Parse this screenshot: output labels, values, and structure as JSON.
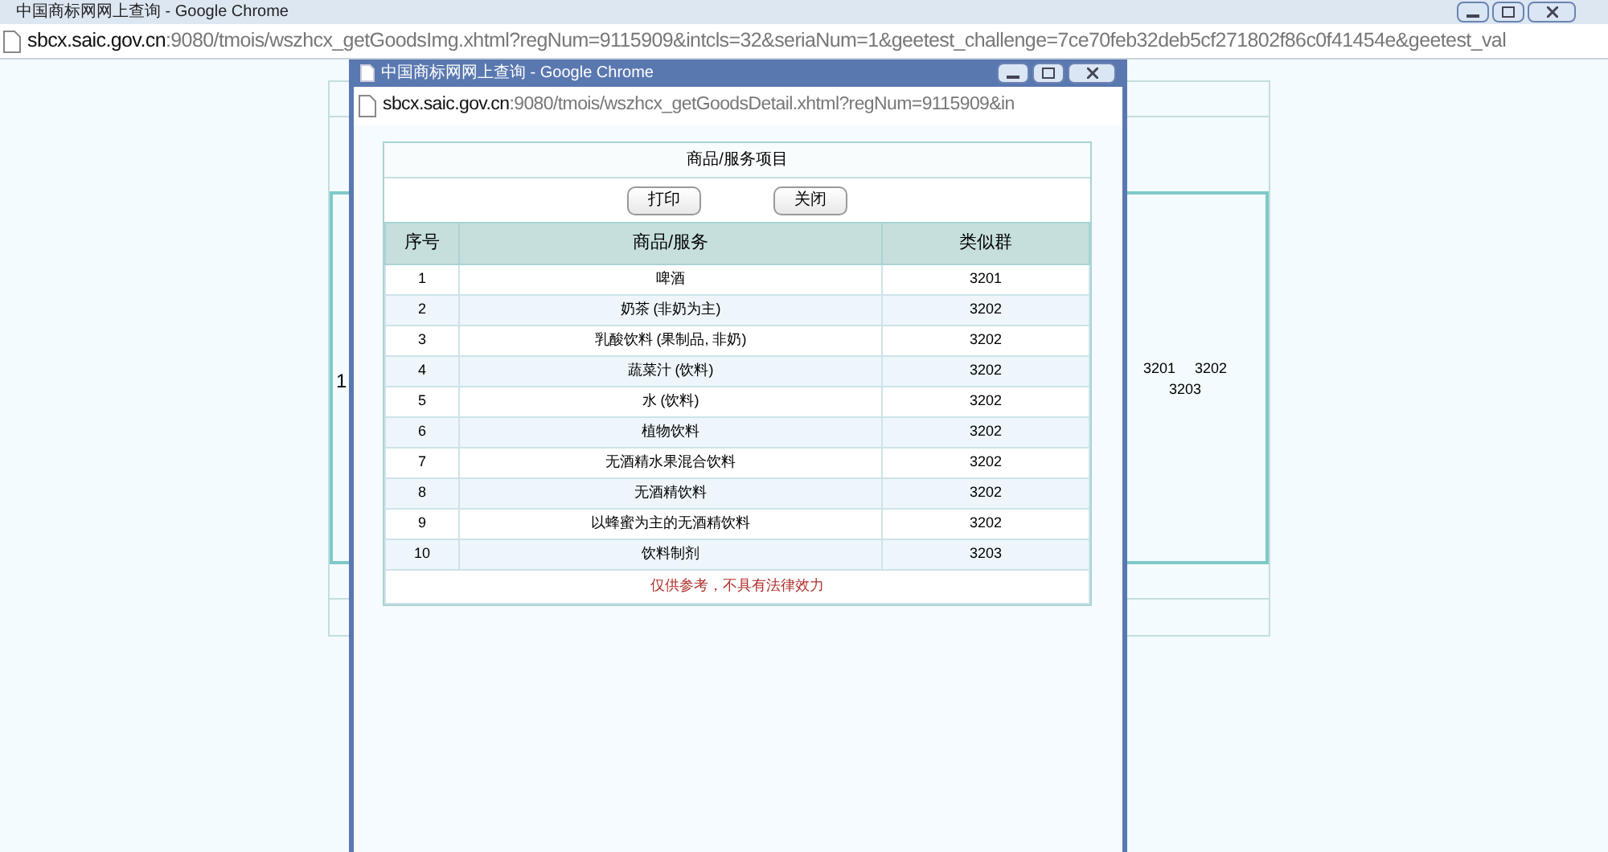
{
  "window": {
    "title": "中国商标网网上查询 - Google Chrome",
    "url_host": "sbcx.saic.gov.cn",
    "url_rest": ":9080/tmois/wszhcx_getGoodsImg.xhtml?regNum=9115909&intcls=32&seriaNum=1&geetest_challenge=7ce70feb32deb5cf271802f86c0f41454e&geetest_val"
  },
  "background_page": {
    "left_fragment": "1",
    "groups": [
      "3201",
      "3202",
      "3203"
    ]
  },
  "popup": {
    "title": "中国商标网网上查询 - Google Chrome",
    "url_host": "sbcx.saic.gov.cn",
    "url_rest": ":9080/tmois/wszhcx_getGoodsDetail.xhtml?regNum=9115909&in",
    "panel_title": "商品/服务项目",
    "buttons": [
      "打印",
      "关闭"
    ],
    "table": {
      "columns": [
        "序号",
        "商品/服务",
        "类似群"
      ],
      "rows": [
        [
          "1",
          "啤酒",
          "3201"
        ],
        [
          "2",
          "奶茶 (非奶为主)",
          "3202"
        ],
        [
          "3",
          "乳酸饮料 (果制品, 非奶)",
          "3202"
        ],
        [
          "4",
          "蔬菜汁 (饮料)",
          "3202"
        ],
        [
          "5",
          "水 (饮料)",
          "3202"
        ],
        [
          "6",
          "植物饮料",
          "3202"
        ],
        [
          "7",
          "无酒精水果混合饮料",
          "3202"
        ],
        [
          "8",
          "无酒精饮料",
          "3202"
        ],
        [
          "9",
          "以蜂蜜为主的无酒精饮料",
          "3202"
        ],
        [
          "10",
          "饮料制剂",
          "3203"
        ]
      ]
    },
    "footnote": "仅供参考，不具有法律效力"
  }
}
